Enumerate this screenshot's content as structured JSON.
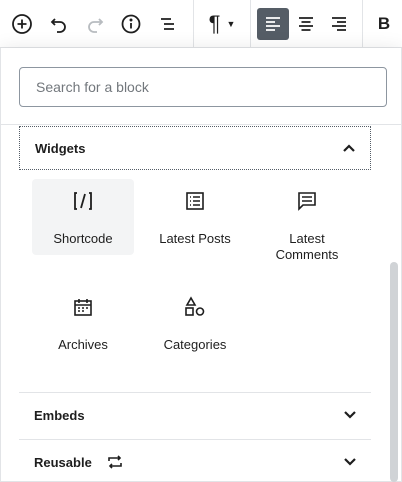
{
  "toolbar": {
    "add_block": "add-block",
    "undo": "undo",
    "redo": "redo",
    "info": "info",
    "outline": "outline",
    "paragraph_symbol": "¶",
    "bold": "B"
  },
  "search": {
    "placeholder": "Search for a block",
    "value": ""
  },
  "sections": {
    "widgets": {
      "title": "Widgets",
      "expanded": true
    },
    "embeds": {
      "title": "Embeds",
      "expanded": false
    },
    "reusable": {
      "title": "Reusable",
      "expanded": false
    }
  },
  "blocks": [
    {
      "label": "Shortcode",
      "icon": "shortcode-icon"
    },
    {
      "label": "Latest Posts",
      "icon": "latest-posts-icon"
    },
    {
      "label": "Latest Comments",
      "icon": "latest-comments-icon"
    },
    {
      "label": "Archives",
      "icon": "archives-icon"
    },
    {
      "label": "Categories",
      "icon": "categories-icon"
    }
  ],
  "colors": {
    "active_bg": "#555d66",
    "hover_bg": "#f3f4f5",
    "border": "#e2e4e7"
  }
}
